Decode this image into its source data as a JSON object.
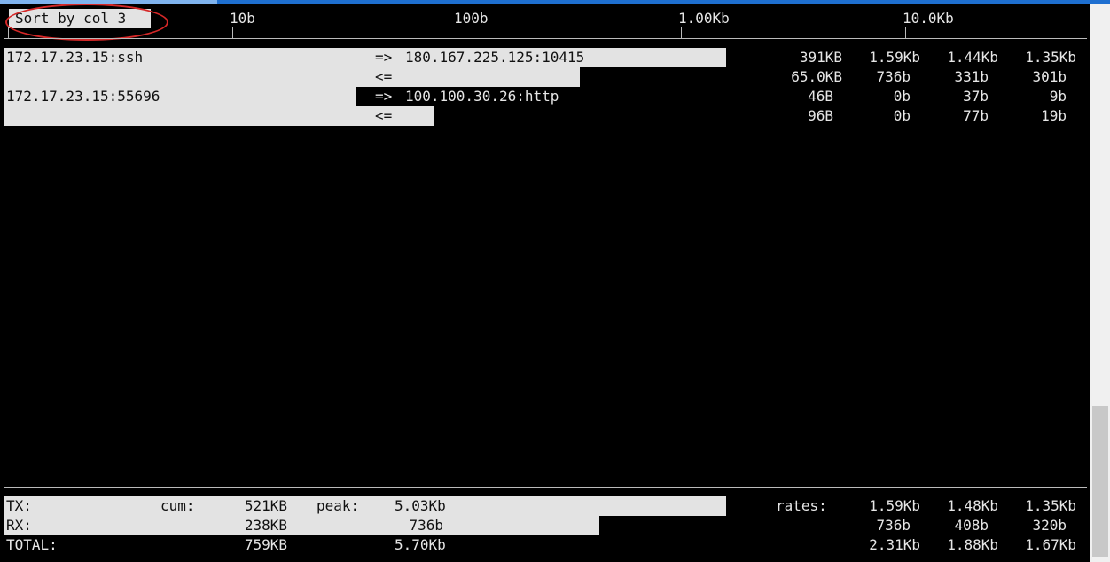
{
  "status": {
    "sort": "Sort by col 3"
  },
  "scale": {
    "labels": [
      "10b",
      "100b",
      "1.00Kb",
      "10.0Kb"
    ]
  },
  "connections": [
    {
      "local": "172.17.23.15:ssh",
      "tx_arrow": "=>",
      "remote": "180.167.225.125:10415",
      "rx_arrow": "<=",
      "tx": {
        "cum": "391KB",
        "r2": "1.59Kb",
        "r10": "1.44Kb",
        "r40": "1.35Kb"
      },
      "rx": {
        "cum": "65.0KB",
        "r2": "736b",
        "r10": "331b",
        "r40": "301b"
      }
    },
    {
      "local": "172.17.23.15:55696",
      "tx_arrow": "=>",
      "remote": "100.100.30.26:http",
      "rx_arrow": "<=",
      "tx": {
        "cum": "46B",
        "r2": "0b",
        "r10": "37b",
        "r40": "9b"
      },
      "rx": {
        "cum": "96B",
        "r2": "0b",
        "r10": "77b",
        "r40": "19b"
      }
    }
  ],
  "totals": {
    "cum_label": "cum:",
    "peak_label": "peak:",
    "rates_label": "rates:",
    "tx": {
      "label": "TX:",
      "cum": "521KB",
      "peak": "5.03Kb",
      "r2": "1.59Kb",
      "r10": "1.48Kb",
      "r40": "1.35Kb"
    },
    "rx": {
      "label": "RX:",
      "cum": "238KB",
      "peak": "736b",
      "r2": "736b",
      "r10": "408b",
      "r40": "320b"
    },
    "total": {
      "label": "TOTAL:",
      "cum": "759KB",
      "peak": "5.70Kb",
      "r2": "2.31Kb",
      "r10": "1.88Kb",
      "r40": "1.67Kb"
    }
  },
  "colors": {
    "background": "#000000",
    "bar": "#e3e3e3",
    "text": "#e6e6e6",
    "annotation": "#d62828",
    "window_accent": "#1e6fd0"
  }
}
